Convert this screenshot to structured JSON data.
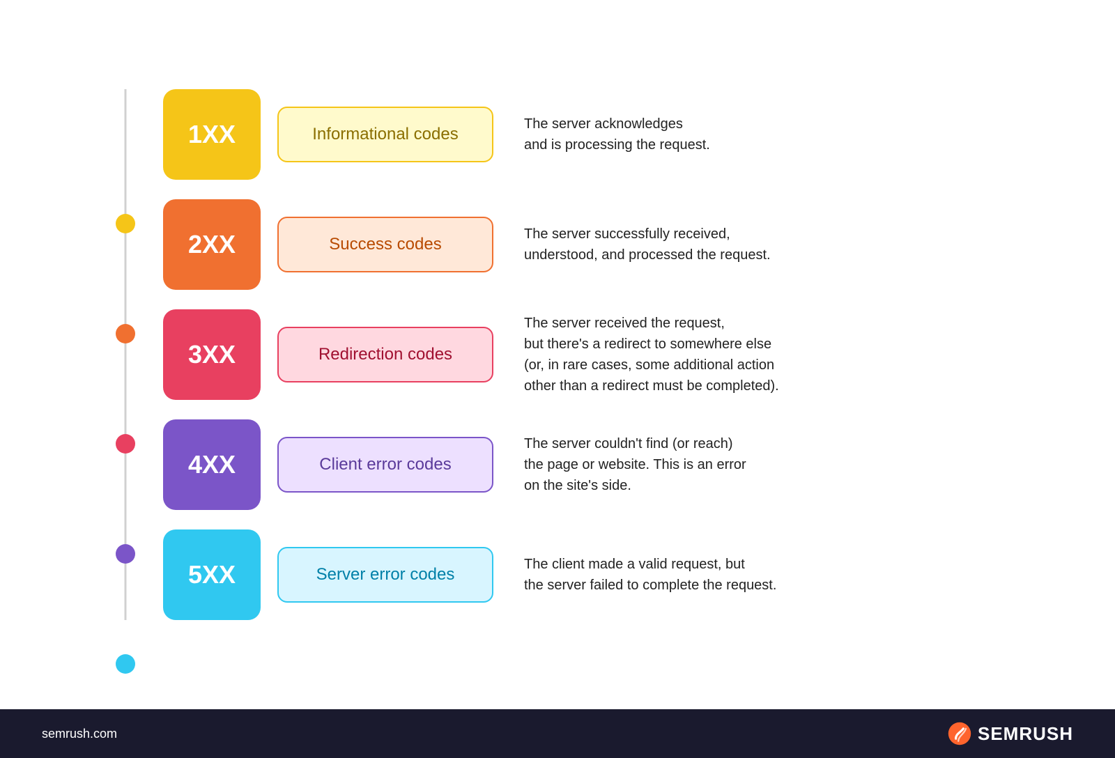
{
  "rows": [
    {
      "id": "row-1",
      "code": "1XX",
      "name": "Informational codes",
      "description": "The server acknowledges\nand is processing the request.",
      "dot_color": "#f5c518",
      "box_color": "#f5c518",
      "name_bg": "#fffacc",
      "name_border": "#f5c518",
      "name_text_color": "#8a6e00"
    },
    {
      "id": "row-2",
      "code": "2XX",
      "name": "Success codes",
      "description": "The server successfully received,\nunderstood, and processed the request.",
      "dot_color": "#f07030",
      "box_color": "#f07030",
      "name_bg": "#ffe8d8",
      "name_border": "#f07030",
      "name_text_color": "#b84a00"
    },
    {
      "id": "row-3",
      "code": "3XX",
      "name": "Redirection codes",
      "description": "The server received the request,\nbut there's a redirect to somewhere else\n(or, in rare cases, some additional action\nother than a redirect must be completed).",
      "dot_color": "#e84060",
      "box_color": "#e84060",
      "name_bg": "#ffd8e0",
      "name_border": "#e84060",
      "name_text_color": "#a01030"
    },
    {
      "id": "row-4",
      "code": "4XX",
      "name": "Client error codes",
      "description": "The server couldn't find (or reach)\nthe page or website. This is an error\non the site's side.",
      "dot_color": "#7b55c8",
      "box_color": "#7b55c8",
      "name_bg": "#ede0ff",
      "name_border": "#7b55c8",
      "name_text_color": "#5a3a9a"
    },
    {
      "id": "row-5",
      "code": "5XX",
      "name": "Server error codes",
      "description": "The client made a valid request, but\nthe server failed to complete the request.",
      "dot_color": "#30c8f0",
      "box_color": "#30c8f0",
      "name_bg": "#d8f5ff",
      "name_border": "#30c8f0",
      "name_text_color": "#0080a8"
    }
  ],
  "footer": {
    "url": "semrush.com",
    "brand": "SEMRUSH"
  }
}
